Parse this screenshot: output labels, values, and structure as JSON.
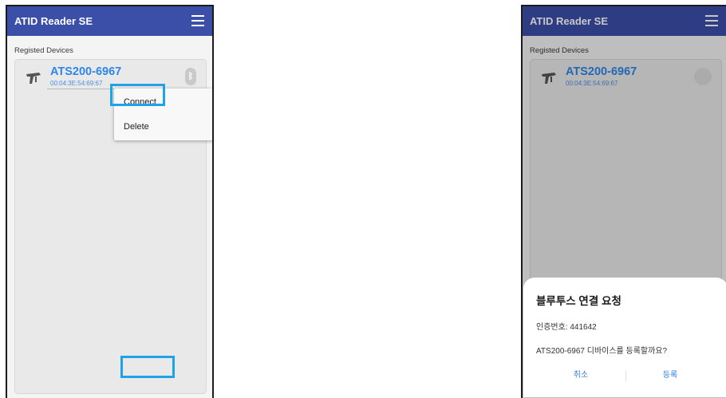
{
  "left_screen": {
    "app_title": "ATID Reader SE",
    "section_label": "Registed Devices",
    "device": {
      "name": "ATS200-6967",
      "mac": "00:04:3E:54:69:67",
      "bluetooth_glyph": "ᛒ"
    },
    "context_menu": {
      "items": [
        {
          "label": "Connect"
        },
        {
          "label": "Delete"
        }
      ]
    }
  },
  "right_screen": {
    "app_title": "ATID Reader SE",
    "section_label": "Registed Devices",
    "device": {
      "name": "ATS200-6967",
      "mac": "00:04:3E:54:69:67"
    },
    "dialog": {
      "title": "블루투스 연결 요청",
      "passkey_line": "인증번호: 441642",
      "question": "ATS200-6967 디바이스를 등록할까요?",
      "cancel_label": "취소",
      "ok_label": "등록"
    }
  },
  "colors": {
    "appbar": "#3b4fa8",
    "device_name": "#2d86e8",
    "highlight": "#1fa3e8"
  },
  "icons": {
    "menu": "hamburger-menu-icon",
    "device": "rfid-scanner-icon",
    "bluetooth": "bluetooth-icon"
  }
}
